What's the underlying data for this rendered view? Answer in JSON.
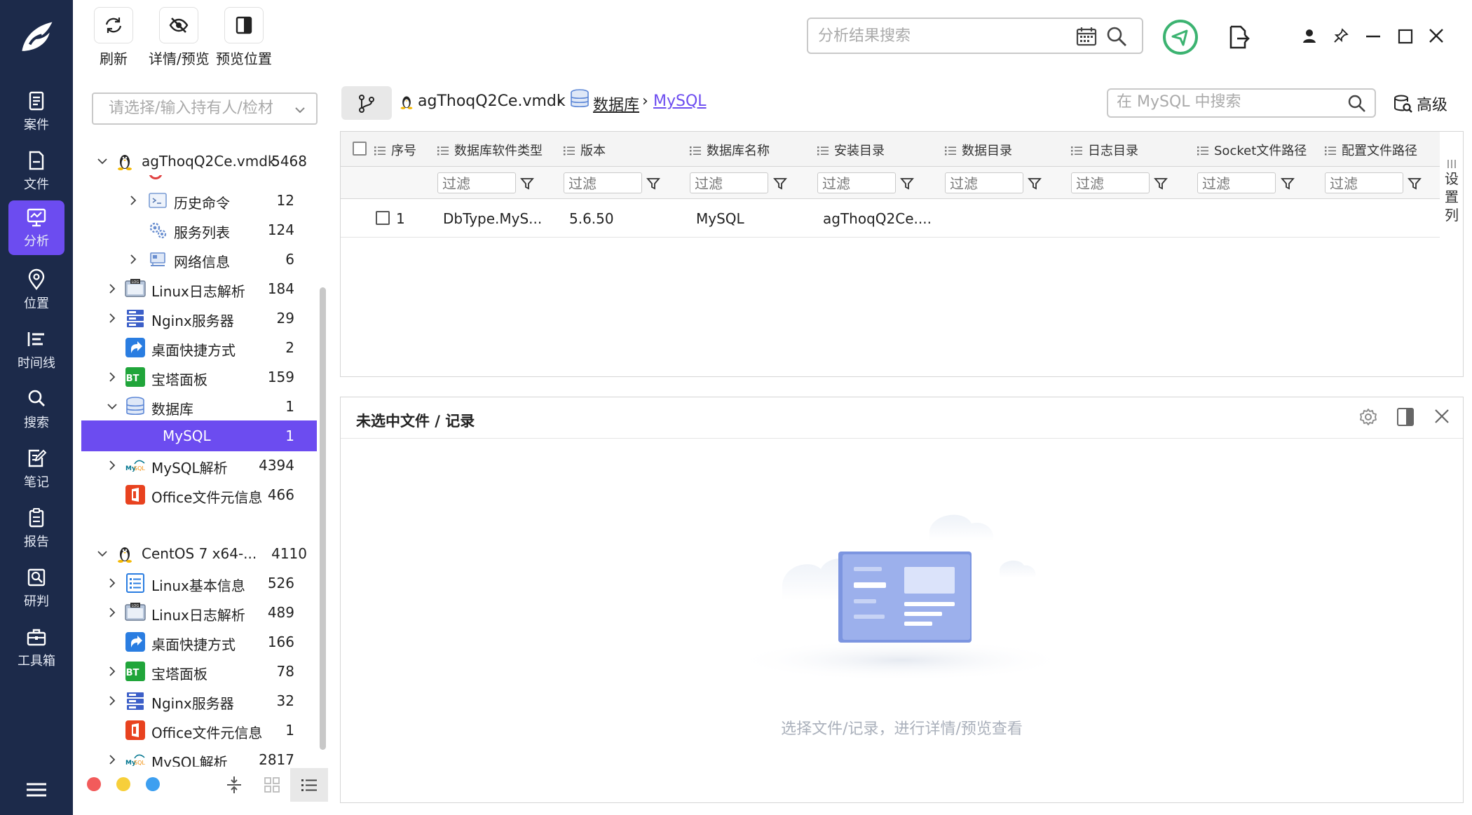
{
  "toolbar": {
    "refresh": "刷新",
    "detail_preview": "详情/预览",
    "preview_position": "预览位置"
  },
  "search": {
    "global_placeholder": "分析结果搜索",
    "holder_placeholder": "请选择/输入持有人/检材",
    "table_placeholder": "在 MySQL 中搜索",
    "advanced": "高级"
  },
  "nav": {
    "items": [
      {
        "label": "案件",
        "icon": "case-icon"
      },
      {
        "label": "文件",
        "icon": "file-icon"
      },
      {
        "label": "分析",
        "icon": "analysis-icon"
      },
      {
        "label": "位置",
        "icon": "location-icon"
      },
      {
        "label": "时间线",
        "icon": "timeline-icon"
      },
      {
        "label": "搜索",
        "icon": "search-icon"
      },
      {
        "label": "笔记",
        "icon": "notes-icon"
      },
      {
        "label": "报告",
        "icon": "report-icon"
      },
      {
        "label": "研判",
        "icon": "judge-icon"
      },
      {
        "label": "工具箱",
        "icon": "toolbox-icon"
      }
    ],
    "active_color": "#6c4cf0",
    "bg_color": "#1c2a4a"
  },
  "tree": {
    "rows": [
      {
        "label": "agThoqQ2Ce.vmdk",
        "count": "5468"
      },
      {
        "label": "历史命令",
        "count": "12"
      },
      {
        "label": "服务列表",
        "count": "124"
      },
      {
        "label": "网络信息",
        "count": "6"
      },
      {
        "label": "Linux日志解析",
        "count": "184"
      },
      {
        "label": "Nginx服务器",
        "count": "29"
      },
      {
        "label": "桌面快捷方式",
        "count": "2"
      },
      {
        "label": "宝塔面板",
        "count": "159"
      },
      {
        "label": "数据库",
        "count": "1"
      },
      {
        "label": "MySQL",
        "count": "1"
      },
      {
        "label": "MySQL解析",
        "count": "4394"
      },
      {
        "label": "Office文件元信息",
        "count": "466"
      },
      {
        "label": "CentOS 7 x64-...",
        "count": "4110"
      },
      {
        "label": "Linux基本信息",
        "count": "526"
      },
      {
        "label": "Linux日志解析",
        "count": "489"
      },
      {
        "label": "桌面快捷方式",
        "count": "166"
      },
      {
        "label": "宝塔面板",
        "count": "78"
      },
      {
        "label": "Nginx服务器",
        "count": "32"
      },
      {
        "label": "Office文件元信息",
        "count": "1"
      },
      {
        "label": "MySQL解析",
        "count": "2817"
      }
    ]
  },
  "breadcrumb": {
    "items": [
      "agThoqQ2Ce.vmdk",
      "数据库",
      "MySQL"
    ],
    "sep": "›"
  },
  "table": {
    "columns": [
      "序号",
      "数据库软件类型",
      "版本",
      "数据库名称",
      "安装目录",
      "数据目录",
      "日志目录",
      "Socket文件路径",
      "配置文件路径"
    ],
    "filter_placeholder": "过滤",
    "rows": [
      {
        "index": "1",
        "type": "DbType.MyS...",
        "version": "5.6.50",
        "name": "MySQL",
        "install_dir": "agThoqQ2Ce...."
      }
    ],
    "column_settings": "设置列"
  },
  "preview": {
    "title": "未选中文件 / 记录",
    "empty_text": "选择文件/记录，进行详情/预览查看"
  }
}
